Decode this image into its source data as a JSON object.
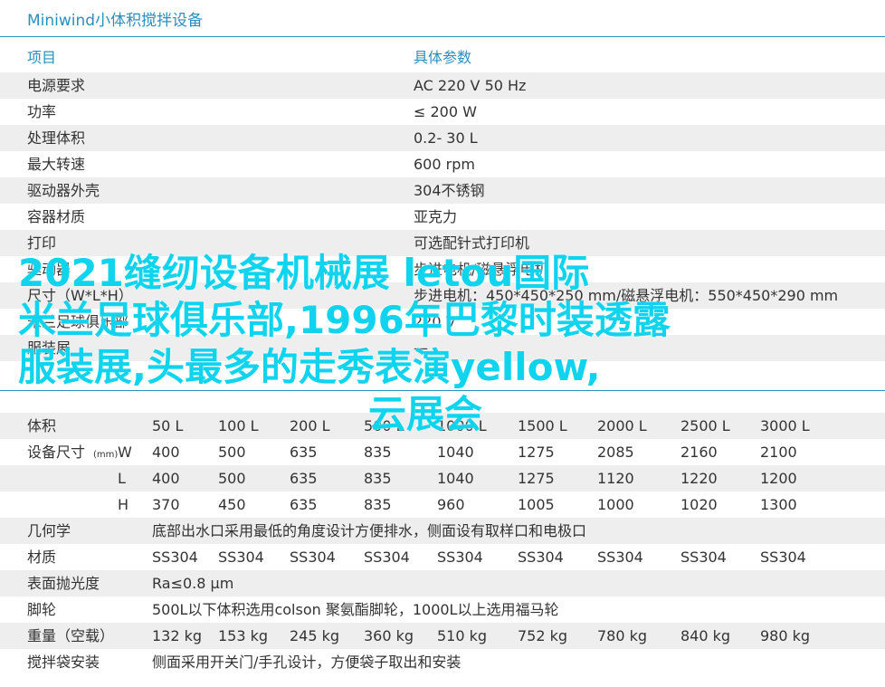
{
  "title": "Miniwind小体积搅拌设备",
  "spec_table": {
    "header": [
      "项目",
      "具体参数"
    ],
    "rows": [
      [
        "电源要求",
        "AC 220  V 50 Hz"
      ],
      [
        "功率",
        "≤ 200 W"
      ],
      [
        "处理体积",
        "0.2- 30 L"
      ],
      [
        "最大转速",
        "600  rpm"
      ],
      [
        "驱动器外壳",
        "304不锈钢"
      ],
      [
        "容器材质",
        "亚克力"
      ],
      [
        "打印",
        "可选配针式打印机"
      ],
      [
        "驱动器",
        "步进电机/磁悬浮电机"
      ],
      [
        "尺寸（W*L*H）",
        "步进电机：450*450*250 mm/磁悬浮电机：550*450*290 mm"
      ],
      [
        "米兰足球俱乐部",
        "220 V"
      ],
      [
        "服装展",
        "—"
      ]
    ]
  },
  "overlay": {
    "lines": [
      "2021缝纫设备机械展 letou国际",
      "米兰足球俱乐部,1996年巴黎时装透露",
      "服装展,头最多的走秀表演yellow,",
      "云展会"
    ]
  },
  "volume_table": {
    "rows": [
      {
        "label": "体积",
        "values": [
          "50 L",
          "100 L",
          "200 L",
          "500 L",
          "1000 L",
          "1500 L",
          "2000 L",
          "2500 L",
          "3000 L"
        ]
      },
      {
        "label": "设备尺寸",
        "unit": "(mm)",
        "dim": "W",
        "values": [
          "400",
          "500",
          "635",
          "835",
          "1040",
          "1275",
          "2085",
          "2160",
          "2100"
        ]
      },
      {
        "label": "",
        "dim": "L",
        "values": [
          "400",
          "500",
          "635",
          "835",
          "1040",
          "1275",
          "1120",
          "1220",
          "1200"
        ]
      },
      {
        "label": "",
        "dim": "H",
        "values": [
          "370",
          "450",
          "635",
          "835",
          "960",
          "1005",
          "1000",
          "1020",
          "1300"
        ]
      },
      {
        "label": "几何学",
        "text": "底部出水口采用最低的角度设计方便排水，侧面设有取样口和电极口"
      },
      {
        "label": "材质",
        "values": [
          "SS304",
          "SS304",
          "SS304",
          "SS304",
          "SS304",
          "SS304",
          "SS304",
          "SS304",
          "SS304"
        ]
      },
      {
        "label": "表面抛光度",
        "text": "Ra≤0.8 µm"
      },
      {
        "label": "脚轮",
        "text": "500L以下体积选用colson 聚氨酯脚轮，1000L以上选用福马轮"
      },
      {
        "label": "重量（空载）",
        "values": [
          "132 kg",
          "153 kg",
          "245 kg",
          "360 kg",
          "510 kg",
          "752 kg",
          "780 kg",
          "840 kg",
          "980 kg"
        ]
      },
      {
        "label": "搅拌袋安装",
        "text": "侧面采用开关门/手孔设计，方便袋子取出和安装"
      }
    ]
  }
}
